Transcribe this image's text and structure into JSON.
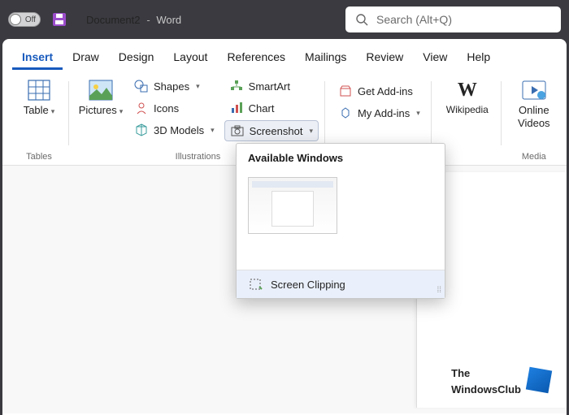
{
  "titlebar": {
    "toggle_label": "Off",
    "doc_name": "Document2",
    "app_name": "Word",
    "search_placeholder": "Search (Alt+Q)"
  },
  "tabs": [
    "Insert",
    "Draw",
    "Design",
    "Layout",
    "References",
    "Mailings",
    "Review",
    "View",
    "Help"
  ],
  "active_tab": "Insert",
  "ribbon": {
    "tables": {
      "label": "Tables",
      "btn": "Table"
    },
    "illustrations": {
      "label": "Illustrations",
      "pictures": "Pictures",
      "shapes": "Shapes",
      "icons": "Icons",
      "models": "3D Models",
      "smartart": "SmartArt",
      "chart": "Chart",
      "screenshot": "Screenshot"
    },
    "addins": {
      "get": "Get Add-ins",
      "my": "My Add-ins"
    },
    "wikipedia": "Wikipedia",
    "media": {
      "label": "Media",
      "videos_line1": "Online",
      "videos_line2": "Videos"
    }
  },
  "dropdown": {
    "header": "Available Windows",
    "clip": "Screen Clipping"
  },
  "watermark": {
    "line1": "The",
    "line2": "WindowsClub"
  }
}
